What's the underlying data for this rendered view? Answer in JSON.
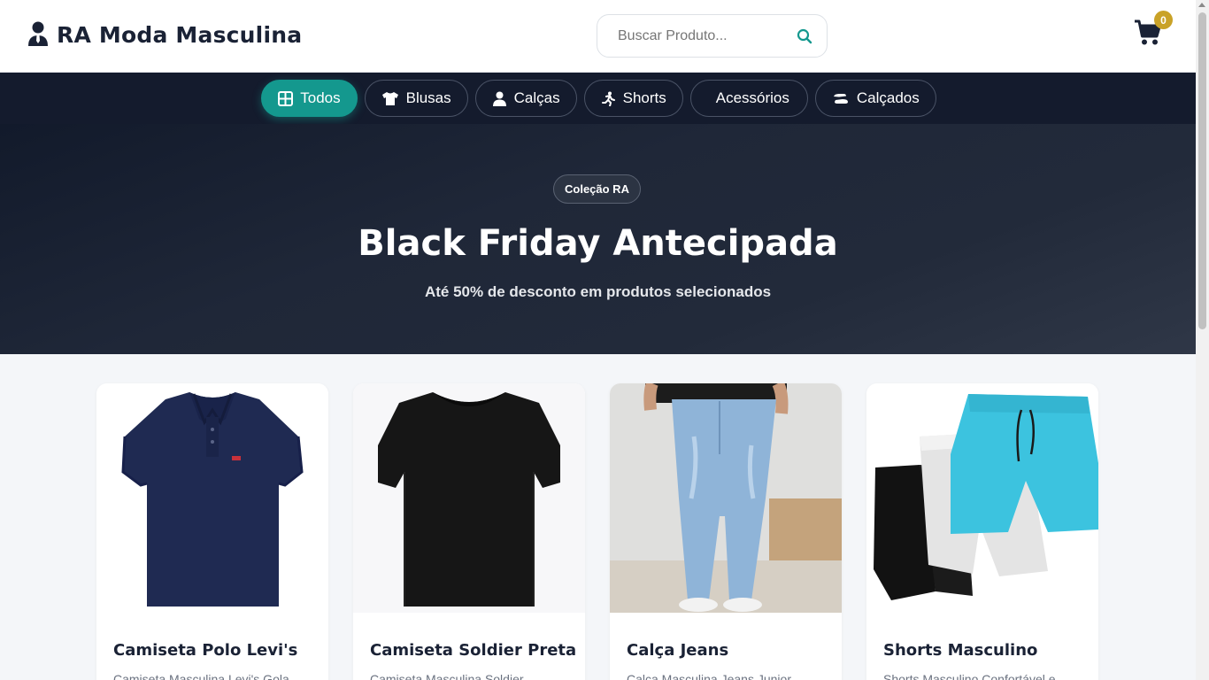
{
  "header": {
    "brand_name": "RA Moda Masculina",
    "search_placeholder": "Buscar Produto...",
    "cart_count": "0"
  },
  "nav": {
    "items": [
      {
        "label": "Todos",
        "icon": "grid-icon",
        "active": true
      },
      {
        "label": "Blusas",
        "icon": "tshirt-icon"
      },
      {
        "label": "Calças",
        "icon": "user-icon"
      },
      {
        "label": "Shorts",
        "icon": "running-icon"
      },
      {
        "label": "Acessórios",
        "icon": ""
      },
      {
        "label": "Calçados",
        "icon": "shoe-icon"
      }
    ]
  },
  "hero": {
    "badge": "Coleção RA",
    "title": "Black Friday Antecipada",
    "subtitle": "Até 50% de desconto em produtos selecionados"
  },
  "products": [
    {
      "title": "Camiseta Polo Levi's",
      "description": "Camiseta Masculina Levi's Gola"
    },
    {
      "title": "Camiseta Soldier Preta",
      "description": "Camiseta Masculina Soldier"
    },
    {
      "title": "Calça Jeans",
      "description": "Calça Masculina Jeans Junior"
    },
    {
      "title": "Shorts Masculino",
      "description": "Shorts Masculino Confortável e"
    }
  ],
  "colors": {
    "accent": "#14988e",
    "nav_bg": "#141b2d",
    "badge": "#c9a227",
    "brand_text": "#1a2235"
  }
}
